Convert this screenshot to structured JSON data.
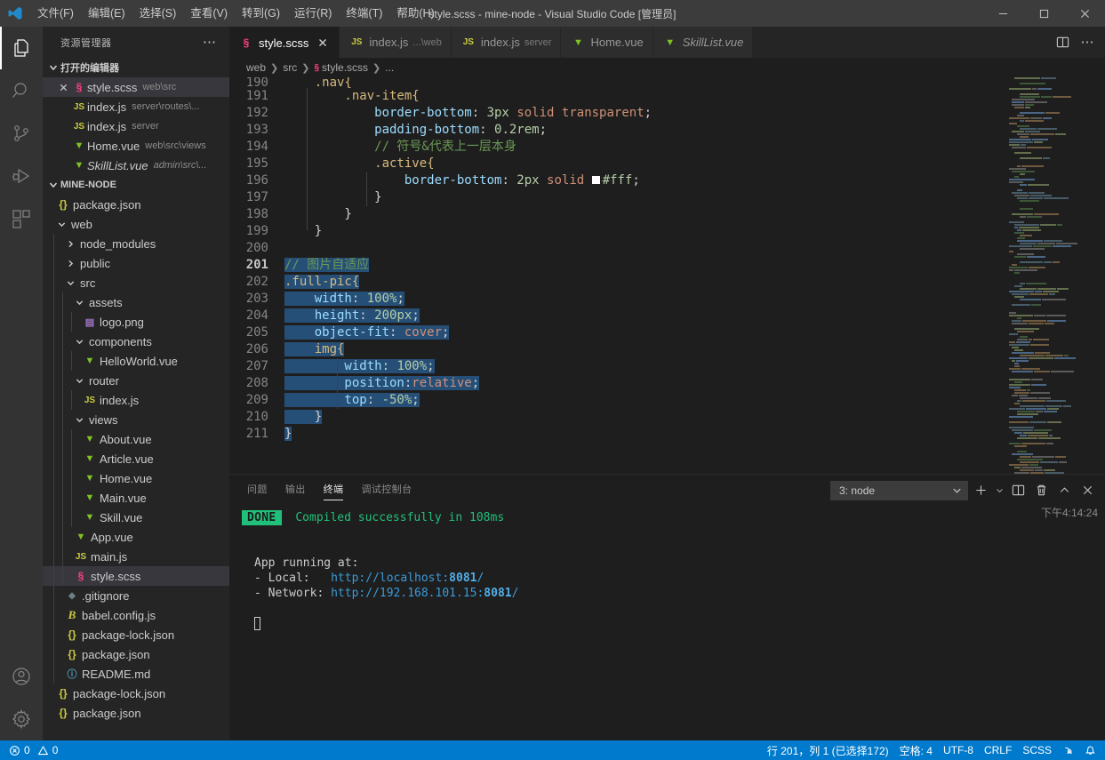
{
  "window": {
    "title": "style.scss - mine-node - Visual Studio Code [管理员]",
    "minimize": "−",
    "maximize": "▢",
    "close": "✕"
  },
  "menu": {
    "items": [
      {
        "label": "文件(F)"
      },
      {
        "label": "编辑(E)"
      },
      {
        "label": "选择(S)"
      },
      {
        "label": "查看(V)"
      },
      {
        "label": "转到(G)"
      },
      {
        "label": "运行(R)"
      },
      {
        "label": "终端(T)"
      },
      {
        "label": "帮助(H)"
      }
    ]
  },
  "activitybar": {
    "items": [
      {
        "name": "explorer-icon",
        "active": true
      },
      {
        "name": "search-icon",
        "active": false
      },
      {
        "name": "source-control-icon",
        "active": false
      },
      {
        "name": "run-debug-icon",
        "active": false
      },
      {
        "name": "extensions-icon",
        "active": false
      }
    ],
    "bottom": [
      {
        "name": "accounts-icon"
      },
      {
        "name": "settings-gear-icon"
      }
    ]
  },
  "sidebar": {
    "title": "资源管理器",
    "more_label": "⋯",
    "open_editors": {
      "header": "打开的编辑器",
      "items": [
        {
          "icon": "scss",
          "label": "style.scss",
          "desc": "web\\src",
          "selected": true,
          "closable": true,
          "italic": false
        },
        {
          "icon": "js",
          "label": "index.js",
          "desc": "server\\routes\\...",
          "selected": false,
          "closable": false,
          "italic": false
        },
        {
          "icon": "js",
          "label": "index.js",
          "desc": "server",
          "selected": false,
          "closable": false,
          "italic": false
        },
        {
          "icon": "vue",
          "label": "Home.vue",
          "desc": "web\\src\\views",
          "selected": false,
          "closable": false,
          "italic": false
        },
        {
          "icon": "vue",
          "label": "SkillList.vue",
          "desc": "admin\\src\\...",
          "selected": false,
          "closable": false,
          "italic": true
        }
      ]
    },
    "project": {
      "header": "MINE-NODE",
      "tree": [
        {
          "depth": 1,
          "icon": "json",
          "label": "package.json",
          "kind": "file"
        },
        {
          "depth": 1,
          "icon": "",
          "label": "web",
          "kind": "folder",
          "expanded": true
        },
        {
          "depth": 2,
          "icon": "",
          "label": "node_modules",
          "kind": "folder",
          "expanded": false
        },
        {
          "depth": 2,
          "icon": "",
          "label": "public",
          "kind": "folder",
          "expanded": false
        },
        {
          "depth": 2,
          "icon": "",
          "label": "src",
          "kind": "folder",
          "expanded": true
        },
        {
          "depth": 3,
          "icon": "",
          "label": "assets",
          "kind": "folder",
          "expanded": true
        },
        {
          "depth": 4,
          "icon": "png",
          "label": "logo.png",
          "kind": "file"
        },
        {
          "depth": 3,
          "icon": "",
          "label": "components",
          "kind": "folder",
          "expanded": true
        },
        {
          "depth": 4,
          "icon": "vue",
          "label": "HelloWorld.vue",
          "kind": "file"
        },
        {
          "depth": 3,
          "icon": "",
          "label": "router",
          "kind": "folder",
          "expanded": true
        },
        {
          "depth": 4,
          "icon": "js",
          "label": "index.js",
          "kind": "file"
        },
        {
          "depth": 3,
          "icon": "",
          "label": "views",
          "kind": "folder",
          "expanded": true
        },
        {
          "depth": 4,
          "icon": "vue",
          "label": "About.vue",
          "kind": "file"
        },
        {
          "depth": 4,
          "icon": "vue",
          "label": "Article.vue",
          "kind": "file"
        },
        {
          "depth": 4,
          "icon": "vue",
          "label": "Home.vue",
          "kind": "file"
        },
        {
          "depth": 4,
          "icon": "vue",
          "label": "Main.vue",
          "kind": "file"
        },
        {
          "depth": 4,
          "icon": "vue",
          "label": "Skill.vue",
          "kind": "file"
        },
        {
          "depth": 3,
          "icon": "vue",
          "label": "App.vue",
          "kind": "file"
        },
        {
          "depth": 3,
          "icon": "js",
          "label": "main.js",
          "kind": "file"
        },
        {
          "depth": 3,
          "icon": "scss",
          "label": "style.scss",
          "kind": "file",
          "selected": true
        },
        {
          "depth": 2,
          "icon": "git",
          "label": ".gitignore",
          "kind": "file"
        },
        {
          "depth": 2,
          "icon": "babel",
          "label": "babel.config.js",
          "kind": "file"
        },
        {
          "depth": 2,
          "icon": "json",
          "label": "package-lock.json",
          "kind": "file"
        },
        {
          "depth": 2,
          "icon": "json",
          "label": "package.json",
          "kind": "file"
        },
        {
          "depth": 2,
          "icon": "md",
          "label": "README.md",
          "kind": "file"
        },
        {
          "depth": 1,
          "icon": "json",
          "label": "package-lock.json",
          "kind": "file"
        },
        {
          "depth": 1,
          "icon": "json",
          "label": "package.json",
          "kind": "file"
        }
      ]
    }
  },
  "editor": {
    "tabs": [
      {
        "icon": "scss",
        "label": "style.scss",
        "desc": "",
        "active": true,
        "closable": true,
        "italic": false
      },
      {
        "icon": "js",
        "label": "index.js",
        "desc": "...\\web",
        "active": false,
        "closable": false,
        "italic": false
      },
      {
        "icon": "js",
        "label": "index.js",
        "desc": "server",
        "active": false,
        "closable": false,
        "italic": false
      },
      {
        "icon": "vue",
        "label": "Home.vue",
        "desc": "",
        "active": false,
        "closable": false,
        "italic": false
      },
      {
        "icon": "vue",
        "label": "SkillList.vue",
        "desc": "",
        "active": false,
        "closable": false,
        "italic": true
      }
    ],
    "tab_actions": [
      {
        "name": "split-editor-icon"
      },
      {
        "name": "more-actions-icon",
        "label": "⋯"
      }
    ],
    "breadcrumb": [
      "web",
      "src",
      "style.scss",
      "..."
    ],
    "first_line_number": 190,
    "cursor_line": 201,
    "lines": [
      {
        "n": 190,
        "clipped": true,
        "segments": [
          {
            "t": "sel",
            "s": "    .nav{"
          }
        ]
      },
      {
        "n": 191,
        "segments": [
          {
            "t": "sel",
            "s": "        .nav-item{"
          }
        ]
      },
      {
        "n": 192,
        "segments": [
          {
            "t": "prop",
            "s": "            border-bottom"
          },
          {
            "t": "punc",
            "s": ": "
          },
          {
            "t": "num",
            "s": "3px"
          },
          {
            "t": "punc",
            "s": " "
          },
          {
            "t": "val",
            "s": "solid"
          },
          {
            "t": "punc",
            "s": " "
          },
          {
            "t": "val",
            "s": "transparent"
          },
          {
            "t": "punc",
            "s": ";"
          }
        ]
      },
      {
        "n": 193,
        "segments": [
          {
            "t": "prop",
            "s": "            padding-bottom"
          },
          {
            "t": "punc",
            "s": ": "
          },
          {
            "t": "num",
            "s": "0.2rem"
          },
          {
            "t": "punc",
            "s": ";"
          }
        ]
      },
      {
        "n": 194,
        "segments": [
          {
            "t": "cmt",
            "s": "            // 符号&代表上一层本身"
          }
        ]
      },
      {
        "n": 195,
        "segments": [
          {
            "t": "sel",
            "s": "            .active{"
          }
        ]
      },
      {
        "n": 196,
        "segments": [
          {
            "t": "prop",
            "s": "                border-bottom"
          },
          {
            "t": "punc",
            "s": ": "
          },
          {
            "t": "num",
            "s": "2px"
          },
          {
            "t": "punc",
            "s": " "
          },
          {
            "t": "val",
            "s": "solid"
          },
          {
            "t": "punc",
            "s": " "
          },
          {
            "t": "colorbox",
            "s": ""
          },
          {
            "t": "num",
            "s": "#fff"
          },
          {
            "t": "punc",
            "s": ";"
          }
        ]
      },
      {
        "n": 197,
        "segments": [
          {
            "t": "punc",
            "s": "            }"
          }
        ]
      },
      {
        "n": 198,
        "segments": [
          {
            "t": "punc",
            "s": "        }"
          }
        ]
      },
      {
        "n": 199,
        "segments": [
          {
            "t": "punc",
            "s": "    }"
          }
        ]
      },
      {
        "n": 200,
        "segments": []
      },
      {
        "n": 201,
        "selected": true,
        "segments": [
          {
            "t": "cmt",
            "s": "// 图片自适应"
          }
        ]
      },
      {
        "n": 202,
        "selected": true,
        "segments": [
          {
            "t": "sel",
            "s": ".full-pic{"
          }
        ]
      },
      {
        "n": 203,
        "selected": true,
        "segments": [
          {
            "t": "prop",
            "s": "    width"
          },
          {
            "t": "punc",
            "s": ": "
          },
          {
            "t": "num",
            "s": "100%"
          },
          {
            "t": "punc",
            "s": ";"
          }
        ]
      },
      {
        "n": 204,
        "selected": true,
        "segments": [
          {
            "t": "prop",
            "s": "    height"
          },
          {
            "t": "punc",
            "s": ": "
          },
          {
            "t": "num",
            "s": "200px"
          },
          {
            "t": "punc",
            "s": ";"
          }
        ]
      },
      {
        "n": 205,
        "selected": true,
        "segments": [
          {
            "t": "prop",
            "s": "    object-fit"
          },
          {
            "t": "punc",
            "s": ": "
          },
          {
            "t": "val",
            "s": "cover"
          },
          {
            "t": "punc",
            "s": ";"
          }
        ]
      },
      {
        "n": 206,
        "selected": true,
        "segments": [
          {
            "t": "sel",
            "s": "    img{"
          }
        ]
      },
      {
        "n": 207,
        "selected": true,
        "segments": [
          {
            "t": "prop",
            "s": "        width"
          },
          {
            "t": "punc",
            "s": ": "
          },
          {
            "t": "num",
            "s": "100%"
          },
          {
            "t": "punc",
            "s": ";"
          }
        ]
      },
      {
        "n": 208,
        "selected": true,
        "segments": [
          {
            "t": "prop",
            "s": "        position"
          },
          {
            "t": "punc",
            "s": ":"
          },
          {
            "t": "val",
            "s": "relative"
          },
          {
            "t": "punc",
            "s": ";"
          }
        ]
      },
      {
        "n": 209,
        "selected": true,
        "segments": [
          {
            "t": "prop",
            "s": "        top"
          },
          {
            "t": "punc",
            "s": ": "
          },
          {
            "t": "num",
            "s": "-50%"
          },
          {
            "t": "punc",
            "s": ";"
          }
        ]
      },
      {
        "n": 210,
        "selected": true,
        "segments": [
          {
            "t": "punc",
            "s": "    }"
          }
        ]
      },
      {
        "n": 211,
        "selected": true,
        "segments": [
          {
            "t": "punc",
            "s": "}"
          }
        ]
      }
    ]
  },
  "panel": {
    "tabs": [
      {
        "label": "问题",
        "active": false
      },
      {
        "label": "输出",
        "active": false
      },
      {
        "label": "终端",
        "active": true
      },
      {
        "label": "调试控制台",
        "active": false
      }
    ],
    "terminal_select": {
      "value": "3: node"
    },
    "actions": [
      {
        "name": "new-terminal-icon",
        "label": "+"
      },
      {
        "name": "terminal-dropdown-icon"
      },
      {
        "name": "split-terminal-icon"
      },
      {
        "name": "kill-terminal-icon"
      },
      {
        "name": "maximize-panel-icon"
      },
      {
        "name": "close-panel-icon"
      }
    ],
    "terminal": {
      "status_badge": "DONE",
      "status_message": "Compiled successfully in 108ms",
      "running_label": "App running at:",
      "local_label": "- Local:",
      "local_url_prefix": "http://localhost:",
      "local_port": "8081",
      "local_url_suffix": "/",
      "network_label": "- Network:",
      "network_url_prefix": "http://192.168.101.15:",
      "network_port": "8081",
      "network_url_suffix": "/",
      "timestamp": "下午4:14:24"
    }
  },
  "statusbar": {
    "errors": "0",
    "warnings": "0",
    "cursor_position": "行 201，列 1 (已选择172)",
    "indentation": "空格: 4",
    "encoding": "UTF-8",
    "eol": "CRLF",
    "language": "SCSS",
    "feedback_icon": "smiley-icon",
    "bell_icon": "bell-icon"
  },
  "colors": {
    "accent": "#007acc",
    "statusbar_bg": "#007acc",
    "selection": "#264f78",
    "done_badge": "#21c07a"
  }
}
